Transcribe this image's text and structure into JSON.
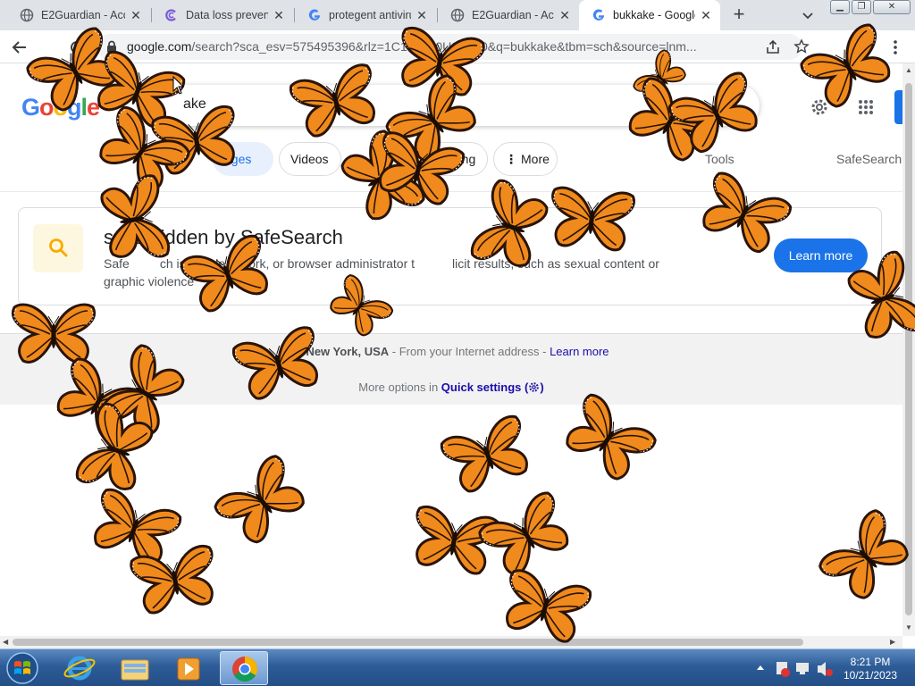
{
  "browser": {
    "tabs": [
      {
        "title": "E2Guardian - Acce",
        "icon": "globe-icon"
      },
      {
        "title": "Data loss prevent",
        "icon": "c-logo-icon"
      },
      {
        "title": "protegent antiviru",
        "icon": "google-g-icon"
      },
      {
        "title": "E2Guardian - Acce",
        "icon": "globe-icon"
      },
      {
        "title": "bukkake - Google",
        "icon": "google-g-icon",
        "active": true
      }
    ],
    "new_tab_label": "+",
    "close_glyph": "✕",
    "url_host": "google.com",
    "url_rest": "/search?sca_esv=575495396&rlz=1C1C",
    "url_tail": "080US1080&q=bukkake&tbm=",
    "url_end": "sch&source=lnm..."
  },
  "search": {
    "logo_text": "Google",
    "query": "bukkake",
    "query_visible": "ake"
  },
  "chips": {
    "images": "Images",
    "images_visible": "ages",
    "videos": "Videos",
    "shopping_visible": "pping",
    "more": "More",
    "tools": "Tools",
    "safesearch": "SafeSearch"
  },
  "safesearch_card": {
    "heading": "sults hidden by SafeSearch",
    "text_line1": "Safe",
    "text_fragment_a": "ch is s",
    "text_fragment_b": "de",
    "text_fragment_c": "twork, or browser administrator t",
    "text_fragment_d": "licit results, such as sexual content or",
    "text_line2": "graphic violence",
    "button": "Learn more"
  },
  "footer": {
    "location": "New York, USA",
    "location_suffix": " - From your Internet address - ",
    "learn_more": "Learn more",
    "more_options": "More options in ",
    "quick_settings": "Quick settings",
    "gear_paren_open": "(",
    "gear_paren_close": ")"
  },
  "taskbar": {
    "time": "8:21 PM",
    "date": "10/21/2023",
    "apps": [
      "internet-explorer-icon",
      "file-explorer-icon",
      "media-player-icon",
      "chrome-icon"
    ]
  },
  "colors": {
    "google_blue": "#4285f4",
    "google_red": "#ea4335",
    "google_yellow": "#fbbc05",
    "google_green": "#34a853",
    "link": "#1a0dab",
    "button_blue": "#1a73e8",
    "butterfly_orange": "#f08a1c",
    "butterfly_vein": "#2a1408"
  },
  "overlay": {
    "type": "butterfly screensaver",
    "count": 30
  }
}
